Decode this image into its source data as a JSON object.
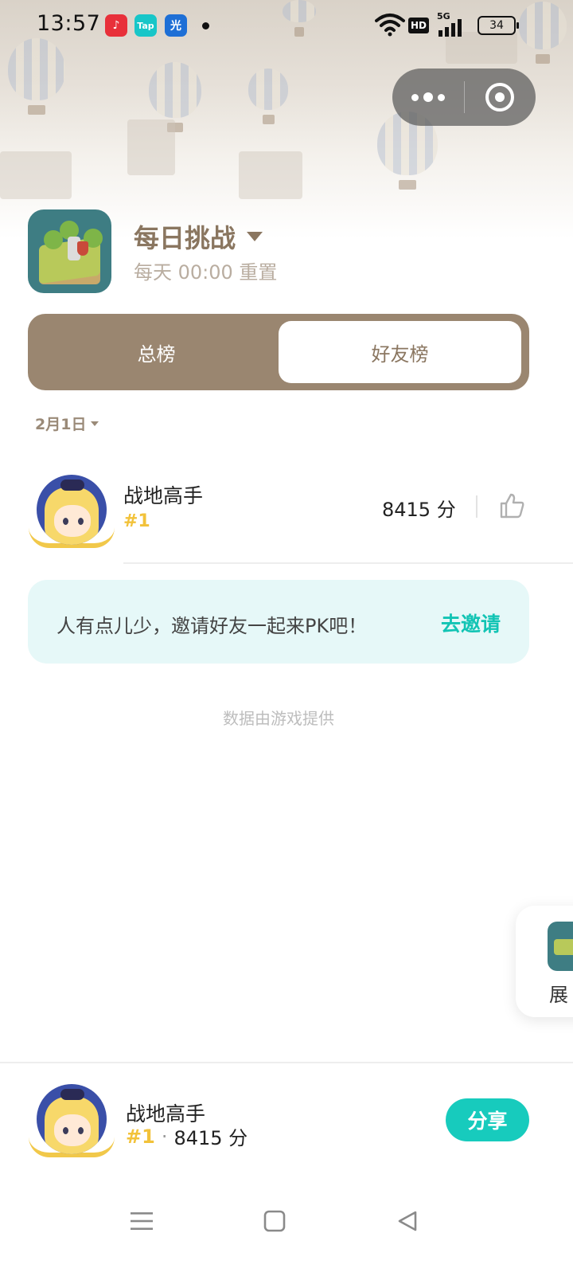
{
  "status_bar": {
    "time": "13:57",
    "notification_icons": [
      {
        "name": "music-app-icon",
        "glyph": "♪",
        "color": "#e8303a"
      },
      {
        "name": "taptap-app-icon",
        "glyph": "Tap",
        "color": "#18c6c8"
      },
      {
        "name": "guang-app-icon",
        "glyph": "光",
        "color": "#1e6fd6"
      }
    ],
    "network_label": "HD",
    "signal_label": "5G",
    "battery": "34"
  },
  "capsule": {
    "more_icon": "more-dots-icon",
    "close_icon": "target-circle-icon"
  },
  "header": {
    "title": "每日挑战",
    "subtitle": "每天 00:00 重置"
  },
  "tabs": [
    {
      "label": "总榜",
      "selected": false
    },
    {
      "label": "好友榜",
      "selected": true
    }
  ],
  "date_selector": "2月1日",
  "leaderboard": [
    {
      "name": "战地高手",
      "rank": "#1",
      "score": "8415 分"
    }
  ],
  "invite": {
    "text": "人有点儿少，邀请好友一起来PK吧！",
    "action": "去邀请"
  },
  "provider_note": "数据由游戏提供",
  "floating_card": {
    "text": "展"
  },
  "my_rank": {
    "name": "战地高手",
    "rank": "#1",
    "separator": "·",
    "score": "8415 分",
    "share_label": "分享"
  },
  "colors": {
    "accent": "#17cbbd",
    "brown": "#9a8670",
    "gold": "#f2c23a",
    "invite_bg": "#e6f8f8"
  }
}
